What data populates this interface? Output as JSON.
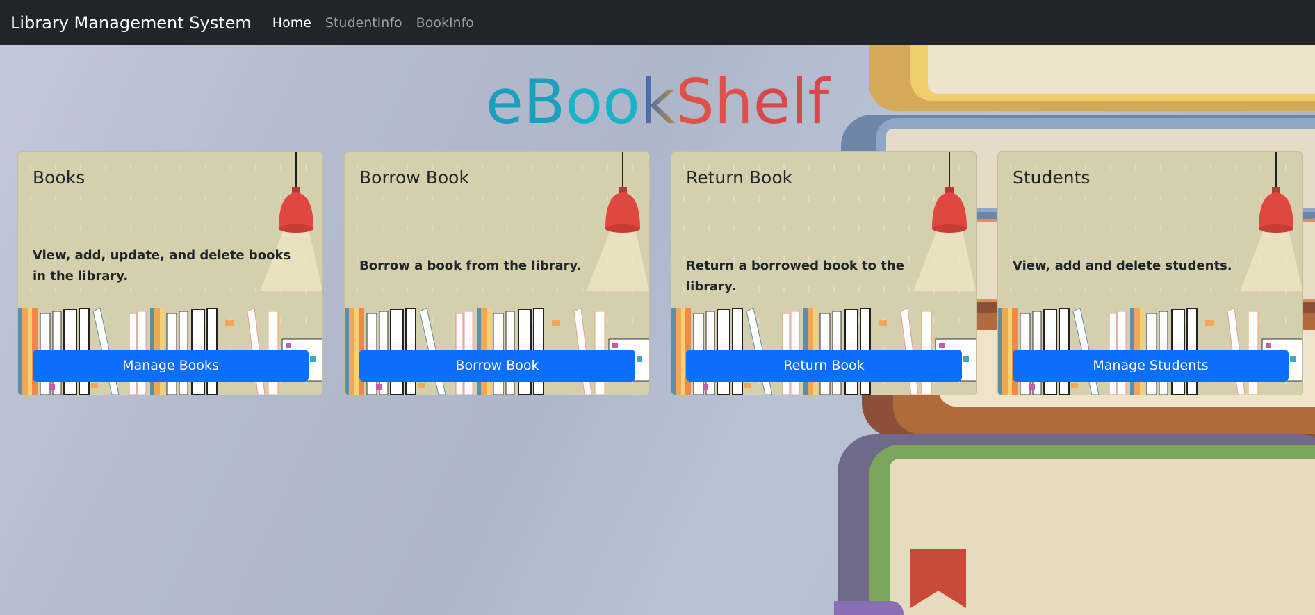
{
  "navbar": {
    "brand": "Library Management System",
    "links": [
      {
        "label": "Home",
        "active": true
      },
      {
        "label": "StudentInfo",
        "active": false
      },
      {
        "label": "BookInfo",
        "active": false
      }
    ]
  },
  "hero": {
    "title_parts": [
      "e",
      "B",
      "oo",
      "k",
      "Sh",
      "elf"
    ]
  },
  "cards": [
    {
      "title": "Books",
      "text": "View, add, update, and delete books in the library.",
      "button": "Manage Books"
    },
    {
      "title": "Borrow Book",
      "text": "Borrow a book from the library.",
      "button": "Borrow Book"
    },
    {
      "title": "Return Book",
      "text": "Return a borrowed book to the library.",
      "button": "Return Book"
    },
    {
      "title": "Students",
      "text": "View, add and delete students.",
      "button": "Manage Students"
    }
  ],
  "colors": {
    "navbar_bg": "#212529",
    "button_bg": "#0d6efd",
    "card_bg": "#d4cfad",
    "lamp": "#e0473e"
  }
}
